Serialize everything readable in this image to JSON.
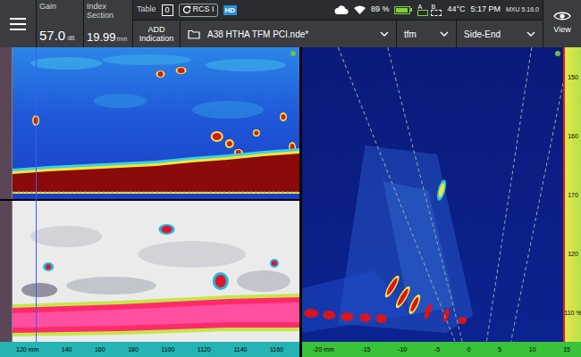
{
  "readouts": [
    {
      "label": "Gain",
      "value": "57.0",
      "unit": "dB"
    },
    {
      "label": "Index Section",
      "value": "19.99",
      "unit": "mm"
    }
  ],
  "table": {
    "label": "Table",
    "value": "0"
  },
  "rcs": {
    "label": "RCS I"
  },
  "hd": {
    "label": "HD"
  },
  "add_button": {
    "label": "ADD Indication"
  },
  "file": {
    "name": "A38 HTHA TFM PCI.nde*"
  },
  "dropdowns": [
    {
      "label": "tfm"
    },
    {
      "label": "Side-End"
    }
  ],
  "status": {
    "battery_text": "89 %",
    "battery_level": 0.89,
    "channels": [
      {
        "label": "A",
        "active": true
      },
      {
        "label": "B",
        "active": false
      }
    ],
    "temperature": "44°C",
    "time": "5:17 PM",
    "version": "MXU 5.16.0"
  },
  "view_button": {
    "label": "View"
  },
  "left_axis": [
    "120 mm",
    "140",
    "160",
    "180",
    "1100",
    "1120",
    "1140",
    "1160"
  ],
  "right_axis": [
    "-20 mm",
    "-15",
    "-10",
    "-5",
    "0",
    "5",
    "10",
    "15"
  ],
  "color_scale": [
    "150",
    "160",
    "170",
    "120",
    "110 %"
  ]
}
